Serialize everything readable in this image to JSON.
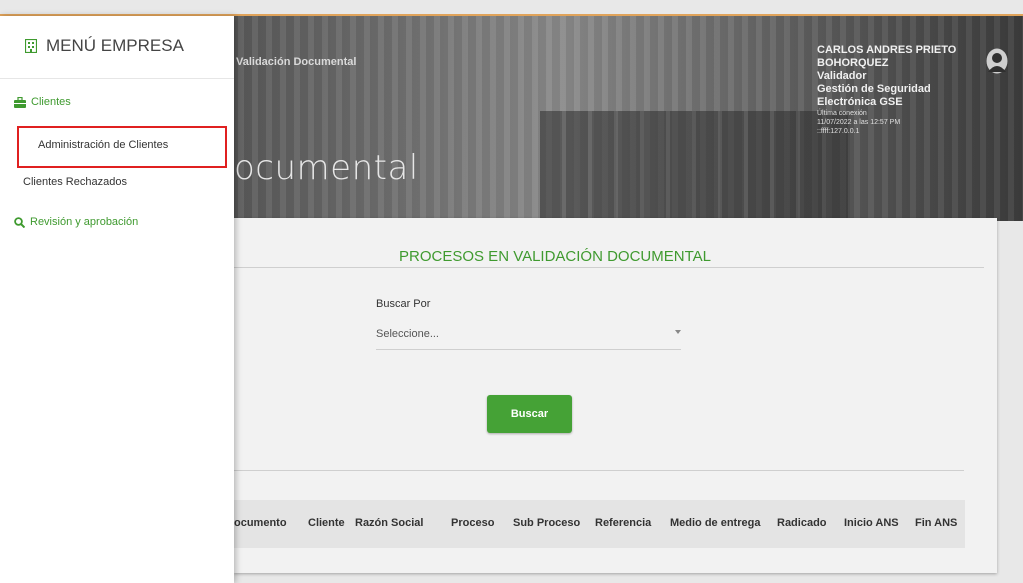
{
  "header": {
    "breadcrumb": "Validación Documental",
    "title_visible": "ocumental",
    "user": {
      "name": "CARLOS ANDRES PRIETO BOHORQUEZ",
      "role": "Validador",
      "company": "Gestión de Seguridad Electrónica GSE",
      "last_login_label": "Última conexión",
      "last_login_date": "11/07/2022 a las 12:57 PM",
      "ip": "::ffff:127.0.0.1"
    },
    "avatar_icon": "user-avatar-icon"
  },
  "sidebar": {
    "title": "MENÚ EMPRESA",
    "title_icon": "building-icon",
    "sections": [
      {
        "label": "Clientes",
        "icon": "briefcase-icon",
        "items": [
          {
            "label": "Administración de Clientes",
            "highlighted": true
          },
          {
            "label": "Clientes Rechazados"
          }
        ]
      },
      {
        "label": "Revisión y aprobación",
        "icon": "search-icon",
        "items": []
      }
    ]
  },
  "main": {
    "card_title": "PROCESOS EN VALIDACIÓN DOCUMENTAL",
    "search_by_label": "Buscar Por",
    "select_value": "Seleccione...",
    "search_button": "Buscar",
    "table_headers": [
      "ocumento",
      "Cliente",
      "Razón Social",
      "Proceso",
      "Sub Proceso",
      "Referencia",
      "Medio de entrega",
      "Radicado",
      "Inicio ANS",
      "Fin ANS"
    ]
  },
  "colors": {
    "accent_green": "#45a236",
    "highlight_red": "#e02020"
  }
}
